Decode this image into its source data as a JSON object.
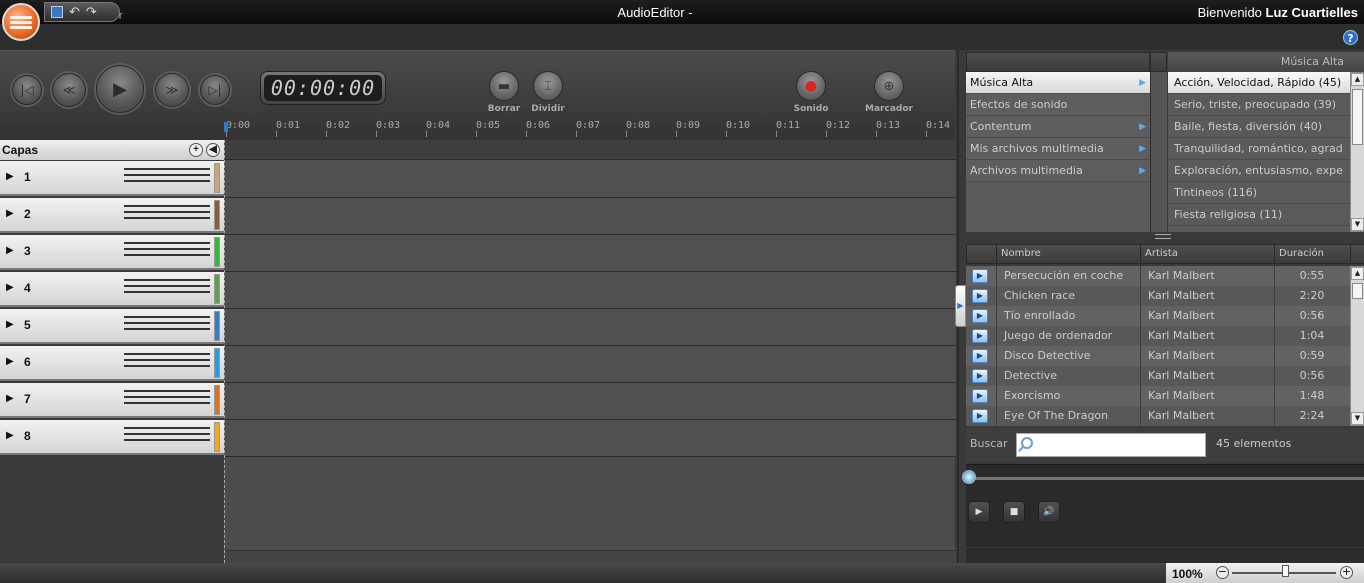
{
  "titlebar": {
    "app": "AudioEditor",
    "separator": " - ",
    "project": "AudioEditor",
    "welcome_prefix": "Bienvenido",
    "user": "Luz Cuartielles"
  },
  "help": {
    "glyph": "?"
  },
  "transport": {
    "timer": "00:00:00",
    "tools": {
      "borrar": "Borrar",
      "dividir": "Dividir",
      "sonido": "Sonido",
      "marcador": "Marcador"
    }
  },
  "ruler": {
    "ticks": [
      "0:00",
      "0:01",
      "0:02",
      "0:03",
      "0:04",
      "0:05",
      "0:06",
      "0:07",
      "0:08",
      "0:09",
      "0:10",
      "0:11",
      "0:12",
      "0:13",
      "0:14"
    ]
  },
  "layers": {
    "title": "Capas",
    "items": [
      {
        "label": "1",
        "color": "#c9a576"
      },
      {
        "label": "2",
        "color": "#8a5a3a"
      },
      {
        "label": "3",
        "color": "#2fbd2f"
      },
      {
        "label": "4",
        "color": "#5aa14a"
      },
      {
        "label": "5",
        "color": "#2f7fc6"
      },
      {
        "label": "6",
        "color": "#1e9fe6"
      },
      {
        "label": "7",
        "color": "#e0701a"
      },
      {
        "label": "8",
        "color": "#f2a81a"
      }
    ]
  },
  "library": {
    "categories": [
      {
        "label": "Música Alta",
        "selected": true
      },
      {
        "label": "Efectos de sonido"
      },
      {
        "label": "Contentum"
      },
      {
        "label": "Mis archivos multimedia"
      },
      {
        "label": "Archivos multimedia"
      }
    ],
    "sub_title": "Música Alta",
    "subcategories": [
      {
        "label": "Acción, Velocidad, Rápido (45)",
        "selected": true
      },
      {
        "label": "Serio, triste, preocupado (39)"
      },
      {
        "label": "Baile, fiesta, diversión (40)"
      },
      {
        "label": "Tranquilidad, romántico, agrad"
      },
      {
        "label": "Exploración, entusiasmo, expe"
      },
      {
        "label": "Tintineos (116)"
      },
      {
        "label": "Fiesta religiosa  (11)"
      }
    ],
    "columns": {
      "name": "Nombre",
      "artist": "Artista",
      "duration": "Duración"
    },
    "songs": [
      {
        "name": "Persecución en coche",
        "artist": "Karl Malbert",
        "duration": "0:55"
      },
      {
        "name": "Chicken race",
        "artist": "Karl Malbert",
        "duration": "2:20"
      },
      {
        "name": "Tío enrollado",
        "artist": "Karl Malbert",
        "duration": "0:56"
      },
      {
        "name": "Juego de ordenador",
        "artist": "Karl Malbert",
        "duration": "1:04"
      },
      {
        "name": "Disco Detective",
        "artist": "Karl Malbert",
        "duration": "0:59"
      },
      {
        "name": "Detective",
        "artist": "Karl Malbert",
        "duration": "0:56"
      },
      {
        "name": "Exorcismo",
        "artist": "Karl Malbert",
        "duration": "1:48"
      },
      {
        "name": "Eye Of The Dragon",
        "artist": "Karl Malbert",
        "duration": "2:24"
      }
    ],
    "search": {
      "label": "Buscar",
      "value": "",
      "placeholder": "",
      "count": "45 elementos"
    }
  },
  "zoom": {
    "value": "100%",
    "level": 0.68
  }
}
